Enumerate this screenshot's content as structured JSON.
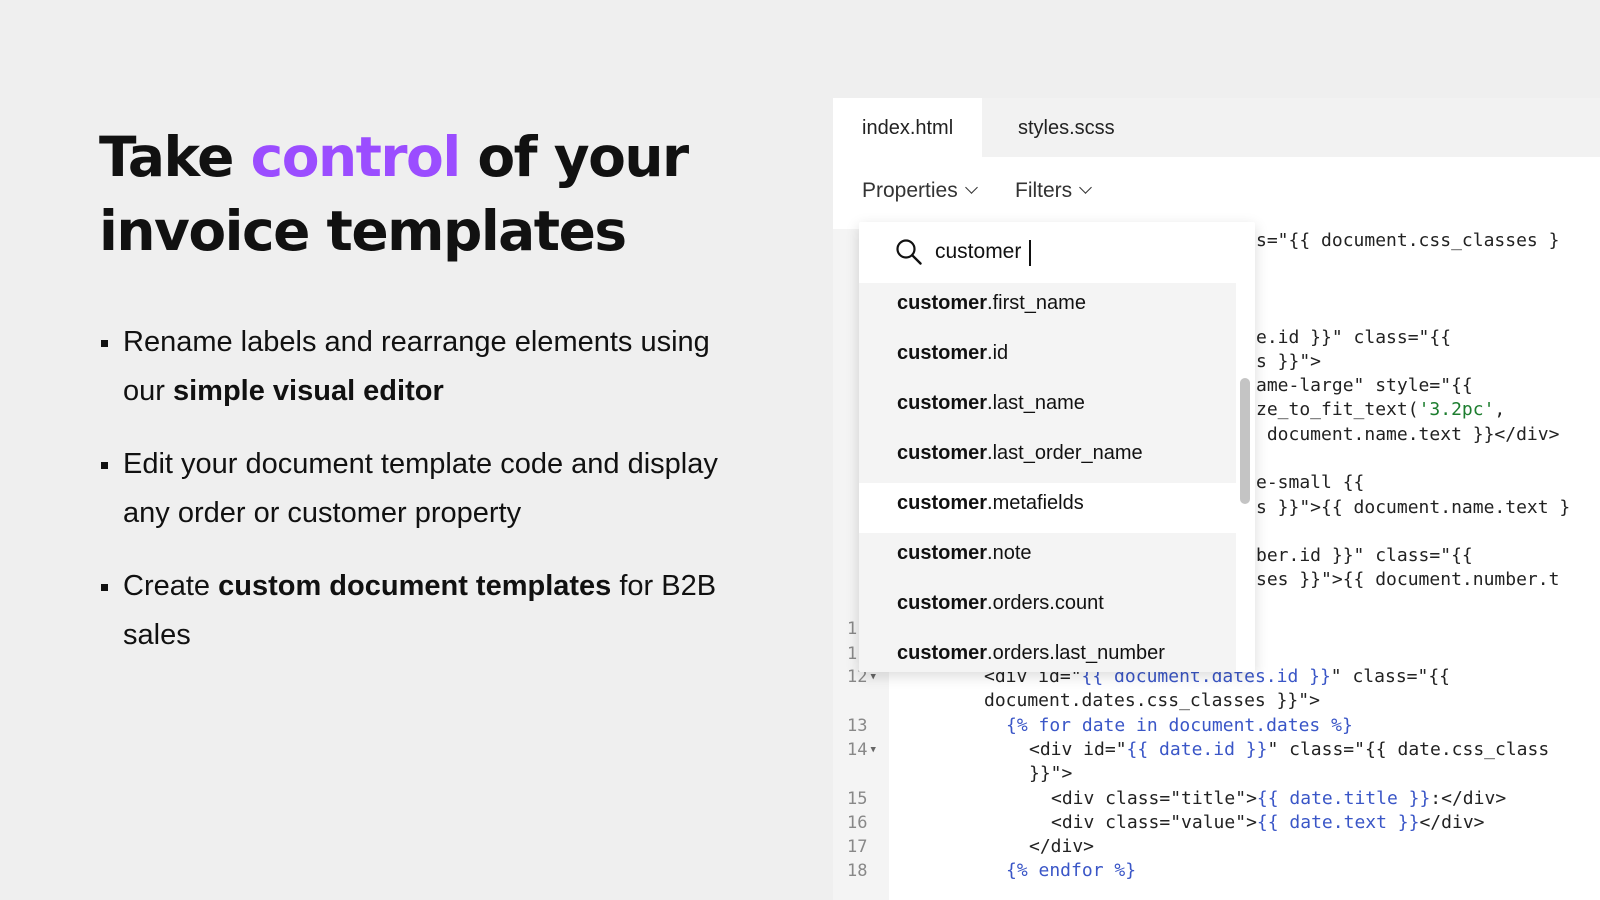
{
  "hero": {
    "headline_pre": "Take ",
    "headline_accent": "control",
    "headline_post": " of your invoice templates",
    "accent_color": "#9b4dff"
  },
  "bullets": [
    {
      "pre": "Rename labels and rearrange elements using our ",
      "bold": "simple visual editor",
      "post": ""
    },
    {
      "pre": "Edit your document template code and display any order or customer property",
      "bold": "",
      "post": ""
    },
    {
      "pre": "Create ",
      "bold": "custom document templates",
      "post": " for B2B sales"
    }
  ],
  "editor": {
    "tabs": [
      "index.html",
      "styles.scss"
    ],
    "active_tab": "index.html",
    "toolbar": [
      "Properties",
      "Filters"
    ],
    "line_numbers": [
      "1",
      "1",
      "12",
      "13",
      "14",
      "15",
      "16",
      "17",
      "18"
    ],
    "code_fragments": {
      "l1": "s=\"{{ document.css_classes }",
      "l2": "e.id }}\" class=\"{{",
      "l3": "s }}\">",
      "l4": "ame-large\" style=\"{{",
      "l5": "ze_to_fit_text('3.2pc',",
      "l6": " document.name.text }}</div>",
      "l7": "e-small {{",
      "l8": "s }}\">{{ document.name.text }",
      "l9": "ber.id }}\" class=\"{{",
      "l10": "ses }}\">{{ document.number.t",
      "l12a": "<div id=\"{{ document.dates.id }}\" class=\"{{",
      "l12b": "document.dates.css_classes }}\">",
      "l13": "{% for date in document.dates %}",
      "l14a": "<div id=\"{{ date.id }}\" class=\"{{ date.css_class",
      "l14b": "}}\">",
      "l15": "<div class=\"title\">{{ date.title }}:</div>",
      "l16": "<div class=\"value\">{{ date.text }}</div>",
      "l17": "</div>",
      "l18": "{% endfor %}"
    }
  },
  "dropdown": {
    "search_value": "customer",
    "options": [
      {
        "bold": "customer",
        "rest": ".first_name"
      },
      {
        "bold": "customer",
        "rest": ".id"
      },
      {
        "bold": "customer",
        "rest": ".last_name"
      },
      {
        "bold": "customer",
        "rest": ".last_order_name"
      },
      {
        "bold": "customer",
        "rest": ".metafields"
      },
      {
        "bold": "customer",
        "rest": ".note"
      },
      {
        "bold": "customer",
        "rest": ".orders.count"
      },
      {
        "bold": "customer",
        "rest": ".orders.last_number"
      }
    ],
    "highlighted_index": 4
  }
}
